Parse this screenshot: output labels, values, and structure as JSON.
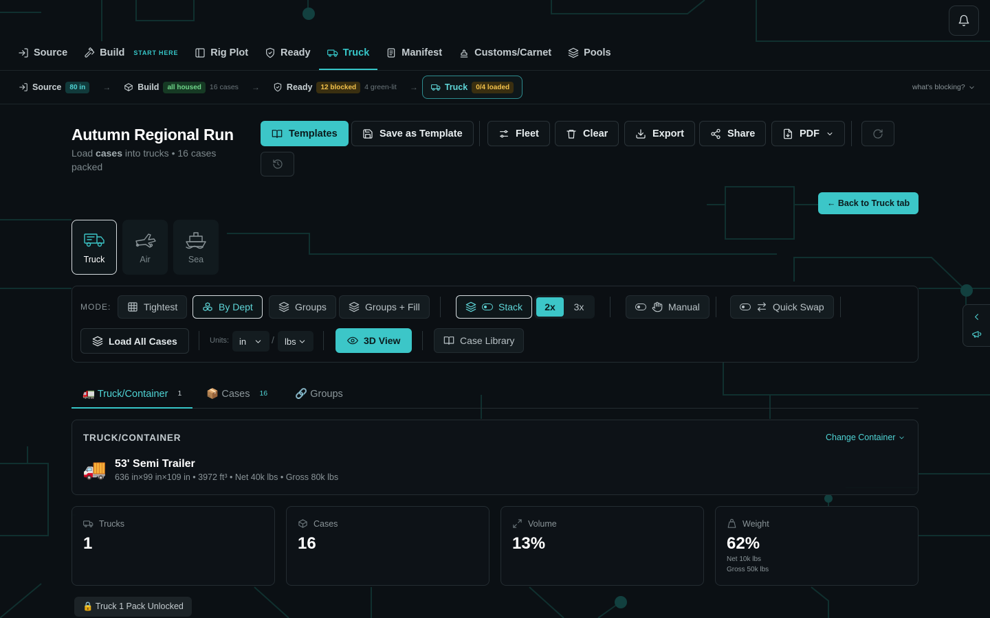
{
  "nav": {
    "items": [
      {
        "label": "Source",
        "icon": "sign-in-icon"
      },
      {
        "label": "Build",
        "icon": "hammer-icon",
        "tag": "START HERE"
      },
      {
        "label": "Rig Plot",
        "icon": "layout-icon"
      },
      {
        "label": "Ready",
        "icon": "shield-check-icon"
      },
      {
        "label": "Truck",
        "icon": "truck-icon",
        "active": true
      },
      {
        "label": "Manifest",
        "icon": "clipboard-icon"
      },
      {
        "label": "Customs/Carnet",
        "icon": "stamp-icon"
      },
      {
        "label": "Pools",
        "icon": "layers-icon"
      }
    ]
  },
  "pipeline": {
    "source": {
      "label": "Source",
      "badge": "80 in"
    },
    "build": {
      "label": "Build",
      "badge": "all housed",
      "note": "16 cases"
    },
    "ready": {
      "label": "Ready",
      "badge": "12 blocked",
      "note": "4 green-lit"
    },
    "truck": {
      "label": "Truck",
      "badge": "0/4 loaded"
    },
    "blocking": "what's blocking?"
  },
  "header": {
    "title": "Autumn Regional Run",
    "subtitle_pre": "Load ",
    "subtitle_bold": "cases",
    "subtitle_post": " into trucks • 16 cases packed"
  },
  "toolbar": {
    "templates": "Templates",
    "save_template": "Save as Template",
    "fleet": "Fleet",
    "clear": "Clear",
    "export": "Export",
    "share": "Share",
    "pdf": "PDF"
  },
  "back_to_truck": "← Back to Truck tab",
  "transport": [
    {
      "label": "Truck",
      "active": true
    },
    {
      "label": "Air"
    },
    {
      "label": "Sea"
    }
  ],
  "mode": {
    "label": "MODE:",
    "tightest": "Tightest",
    "by_dept": "By Dept",
    "groups": "Groups",
    "groups_fill": "Groups + Fill",
    "stack": "Stack",
    "stack_levels": [
      "2x",
      "3x"
    ],
    "stack_selected": "2x",
    "manual": "Manual",
    "quick_swap": "Quick Swap",
    "load_all": "Load All Cases",
    "units_label": "Units:",
    "length_unit": "in",
    "weight_unit": "lbs",
    "view_3d": "3D View",
    "case_library": "Case Library"
  },
  "tabs": [
    {
      "label": "🚛 Truck/Container",
      "count": "1",
      "active": true
    },
    {
      "label": "📦 Cases",
      "count": "16"
    },
    {
      "label": "🔗 Groups",
      "count": ""
    }
  ],
  "container": {
    "heading": "TRUCK/CONTAINER",
    "change": "Change Container",
    "emoji": "🚚",
    "name": "53' Semi Trailer",
    "spec": "636 in×99 in×109 in • 3972 ft³ • Net 40k lbs • Gross 80k lbs"
  },
  "stats": {
    "trucks": {
      "label": "Trucks",
      "value": "1"
    },
    "cases": {
      "label": "Cases",
      "value": "16"
    },
    "volume": {
      "label": "Volume",
      "value": "13%"
    },
    "weight": {
      "label": "Weight",
      "value": "62%",
      "net": "Net 10k lbs",
      "gross": "Gross 50k lbs"
    }
  },
  "lock_status": "🔒 Truck 1 Pack Unlocked",
  "colors": {
    "accent": "#3cc6c8",
    "background": "#0b1014",
    "amber": "#f2c14b",
    "green": "#6fd68a"
  }
}
